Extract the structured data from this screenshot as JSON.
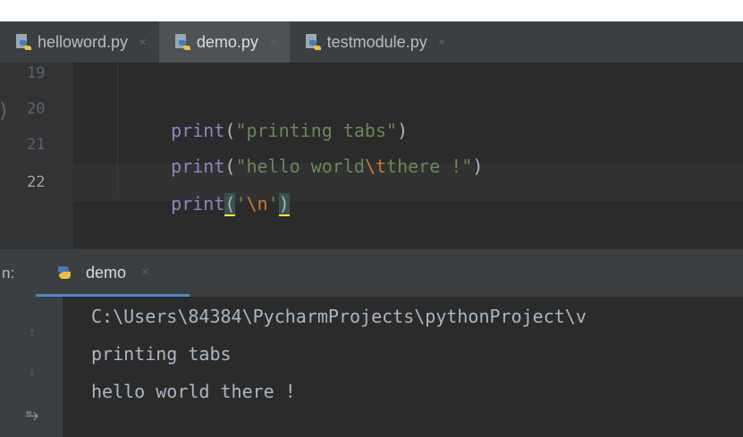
{
  "editor_tabs": [
    {
      "label": "helloword.py",
      "active": false,
      "close": "×"
    },
    {
      "label": "demo.py",
      "active": true,
      "close": "×"
    },
    {
      "label": "testmodule.py",
      "active": false,
      "close": "×"
    }
  ],
  "editor": {
    "line_numbers": [
      "19",
      "20",
      "21",
      "22"
    ],
    "current_line": "22",
    "lines": [
      {
        "fn": "print",
        "open": "(",
        "str_a": "\"printing tabs\"",
        "close": ")"
      },
      {
        "fn": "print",
        "open": "(",
        "str_a": "\"hello world",
        "escape": "\\t",
        "str_b": "there !\"",
        "close": ")"
      },
      {
        "fn": "print",
        "open": "(",
        "str_a": "'",
        "escape": "\\n",
        "str_b": "'",
        "close": ")"
      }
    ]
  },
  "run_panel": {
    "label": "n:",
    "tab_label": "demo",
    "tab_close": "×"
  },
  "console": {
    "lines": [
      "C:\\Users\\84384\\PycharmProjects\\pythonProject\\v",
      "printing tabs",
      "hello world there !"
    ],
    "side_icons": {
      "up": "↑",
      "down": "↓",
      "wrap": "⥱"
    }
  },
  "colors": {
    "background": "#2b2b2b",
    "keyword_print": "#8888c6",
    "string": "#6a8759",
    "escape": "#cc7832",
    "accent_underline": "#4a88c7"
  },
  "icons": {
    "file_tab": "python-file-icon",
    "run_tab": "python-run-icon"
  }
}
